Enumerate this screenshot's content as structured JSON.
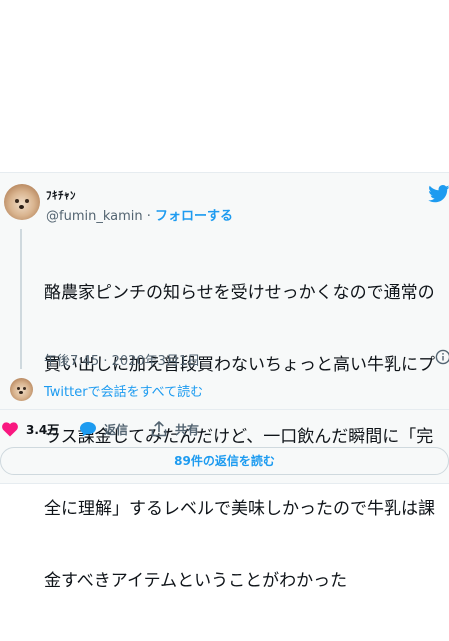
{
  "tweet": {
    "author_name": "ﾌｷﾁｬﾝ",
    "handle": "@fumin_kamin",
    "separator": " · ",
    "follow_label": "フォローする",
    "text_lines": [
      "酪農家ピンチの知らせを受けせっかくなので通常の",
      "買い出しに加え普段買わないちょっと高い牛乳にプ",
      "ラス課金してみたんだけど、一口飲んだ瞬間に「完",
      "全に理解」するレベルで美味しかったので牛乳は課",
      "金すべきアイテムということがわかった"
    ],
    "timestamp": "午後7:45 · 2020年3月1日",
    "read_conversation": "Twitterで会話をすべて読む"
  },
  "actions": {
    "likes_count": "3.4万",
    "reply_label": "返信",
    "share_label": "共有"
  },
  "replies_button_label": "89件の返信を読む",
  "colors": {
    "accent": "#1d9bf0",
    "like": "#f91880",
    "muted": "#536471",
    "card_bg": "#f7f9f9"
  },
  "icons": [
    "twitter-bird-icon",
    "info-icon",
    "heart-icon",
    "reply-bubble-icon",
    "share-icon"
  ]
}
